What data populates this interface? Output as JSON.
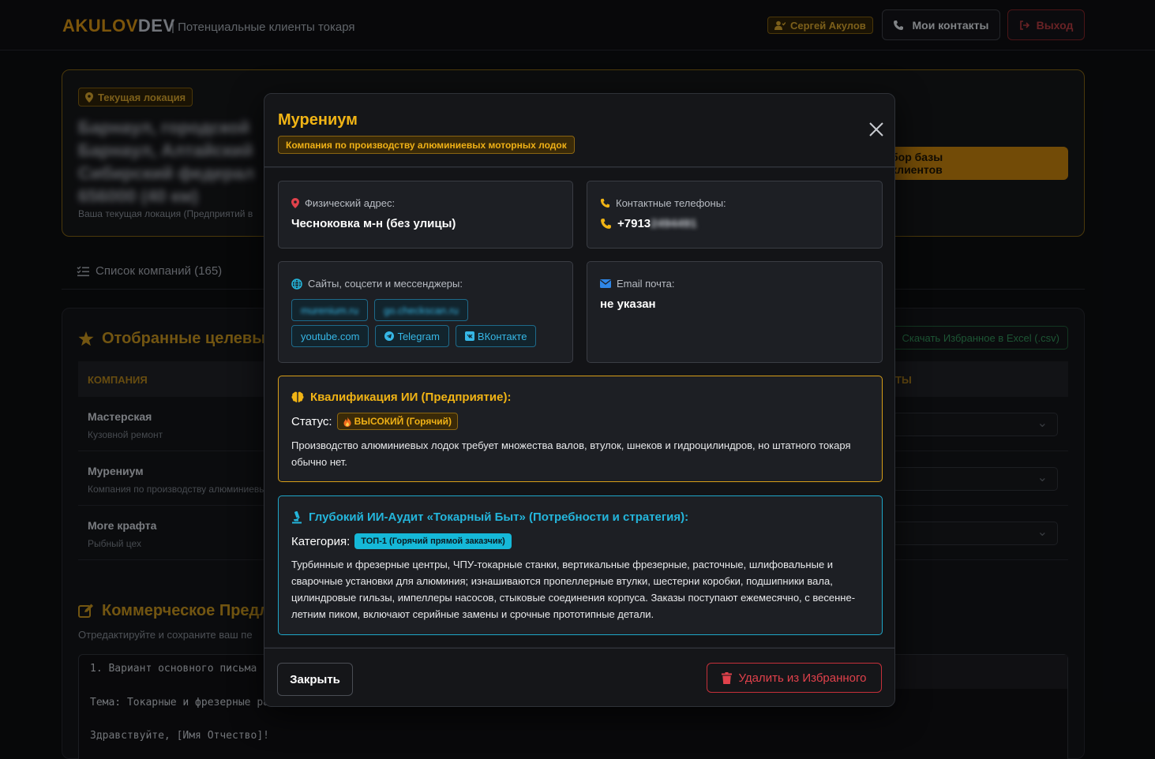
{
  "header": {
    "brand_part1": "AKULOV",
    "brand_part2": "DEV",
    "subtitle": "| Потенциальные клиенты токаря",
    "user_name": "Сергей Акулов",
    "contacts_label": "Мои контакты",
    "logout_label": "Выход"
  },
  "location": {
    "badge": "Текущая локация",
    "address": "Барнаул, городской\nБарнаул, Алтайский\nСибирский федерал\n656000 (40 км)",
    "note": "Ваша текущая локация (Предприятий в",
    "start_button": "бор базы клиентов"
  },
  "tabs": {
    "companies": "Список компаний (165)"
  },
  "favorites": {
    "title": "Отобранные целевые",
    "excel_button": "Скачать Избранное в Excel (.csv)",
    "col_company": "КОМПАНИЯ",
    "col_right": "ТЫ",
    "rows": [
      {
        "name": "Мастерская",
        "desc": "Кузовной ремонт"
      },
      {
        "name": "Мурениум",
        "desc": "Компания по производству алюминиевых моторных лодок"
      },
      {
        "name": "More крафта",
        "desc": "Рыбный цех"
      }
    ]
  },
  "proposal": {
    "title": "Коммерческое Предл",
    "subtitle": "Отредактируйте и сохраните ваш пе",
    "lines": [
      "1. Вариант основного письма",
      "Тема: Токарные и фрезерные ра",
      "Здравствуйте, [Имя Отчество]!"
    ]
  },
  "modal": {
    "title": "Мурениум",
    "subtitle": "Компания по производству алюминиевых моторных лодок",
    "address_label": "Физический адрес:",
    "address_value": "Чесноковка м-н (без улицы)",
    "phones_label": "Контактные телефоны:",
    "phone_visible": "+7913",
    "phone_hidden": "2494491",
    "sites_label": "Сайты, соцсети и мессенджеры:",
    "links": [
      "murenium.ru",
      "go.checkscan.ru",
      "youtube.com",
      "Telegram",
      "ВКонтакте"
    ],
    "email_label": "Email почта:",
    "email_value": "не указан",
    "ai_title": "Квалификация ИИ (Предприятие):",
    "ai_status_label": "Статус:",
    "ai_status_value": "ВЫСОКИЙ (Горячий)",
    "ai_text": "Производство алюминиевых лодок требует множества валов, втулок, шнеков и гидроцилиндров, но штатного токаря обычно нет.",
    "audit_title": "Глубокий ИИ-Аудит «Токарный Быт» (Потребности и стратегия):",
    "audit_cat_label": "Категория:",
    "audit_cat_value": "ТОП-1 (Горячий прямой заказчик)",
    "audit_text": "Турбинные и фрезерные центры, ЧПУ-токарные станки, вертикальные фрезерные, расточные, шлифовальные и сварочные установки для алюминия; изнашиваются пропеллерные втулки, шестерни коробки, подшипники вала, цилиндровые гильзы, импеллеры насосов, стыковые соединения корпуса. Заказы поступают ежемесячно, с весенне-летним пиком, включают серийные замены и срочные прототипные детали.",
    "close_button": "Закрыть",
    "delete_button": "Удалить из Избранного"
  },
  "colors": {
    "accent": "#f1b415",
    "cyan": "#24b6dc",
    "danger": "#e0414b"
  }
}
